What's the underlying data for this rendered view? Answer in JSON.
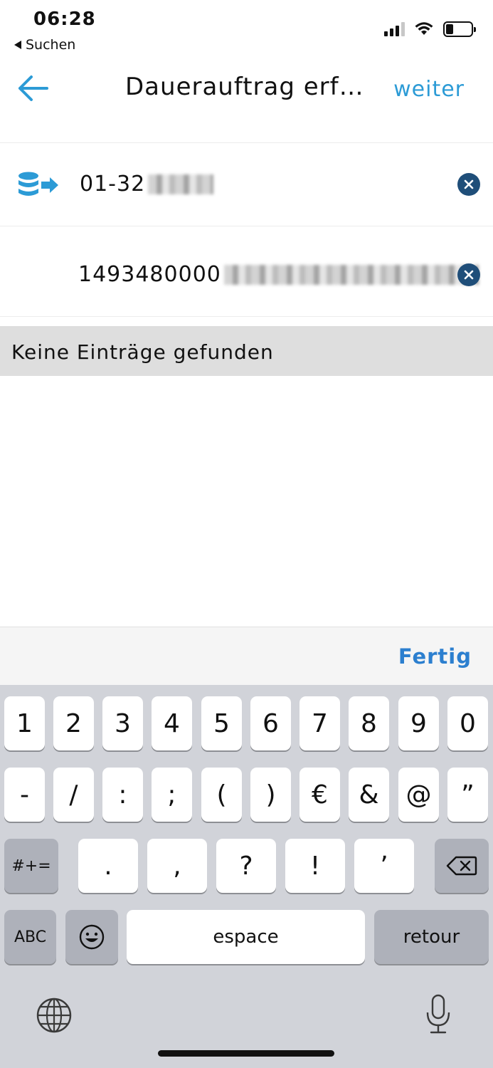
{
  "status": {
    "time": "06:28",
    "back_label": "Suchen"
  },
  "nav": {
    "title": "Dauerauftrag erf…",
    "next_label": "weiter"
  },
  "fields": {
    "account": {
      "value": "01-32"
    },
    "iban": {
      "value": "1493480000"
    }
  },
  "results": {
    "empty_text": "Keine Einträge gefunden"
  },
  "toolbar": {
    "done_label": "Fertig"
  },
  "keyboard": {
    "row1": [
      "1",
      "2",
      "3",
      "4",
      "5",
      "6",
      "7",
      "8",
      "9",
      "0"
    ],
    "row2": [
      "-",
      "/",
      ":",
      ";",
      "(",
      ")",
      "€",
      "&",
      "@",
      "”"
    ],
    "row3_toggle": "#+=",
    "row3": [
      ".",
      ",",
      "?",
      "!",
      "’"
    ],
    "abc": "ABC",
    "space": "espace",
    "return": "retour"
  },
  "colors": {
    "accent": "#2c9bd6",
    "clear_button": "#1f4e79",
    "keyboard_bg": "#d1d3d9"
  },
  "icons": {
    "back": "arrow-left-icon",
    "account": "coin-stack-transfer-icon",
    "clear": "clear-x-icon",
    "backspace": "backspace-icon",
    "emoji": "emoji-icon",
    "globe": "globe-icon",
    "mic": "microphone-icon"
  }
}
